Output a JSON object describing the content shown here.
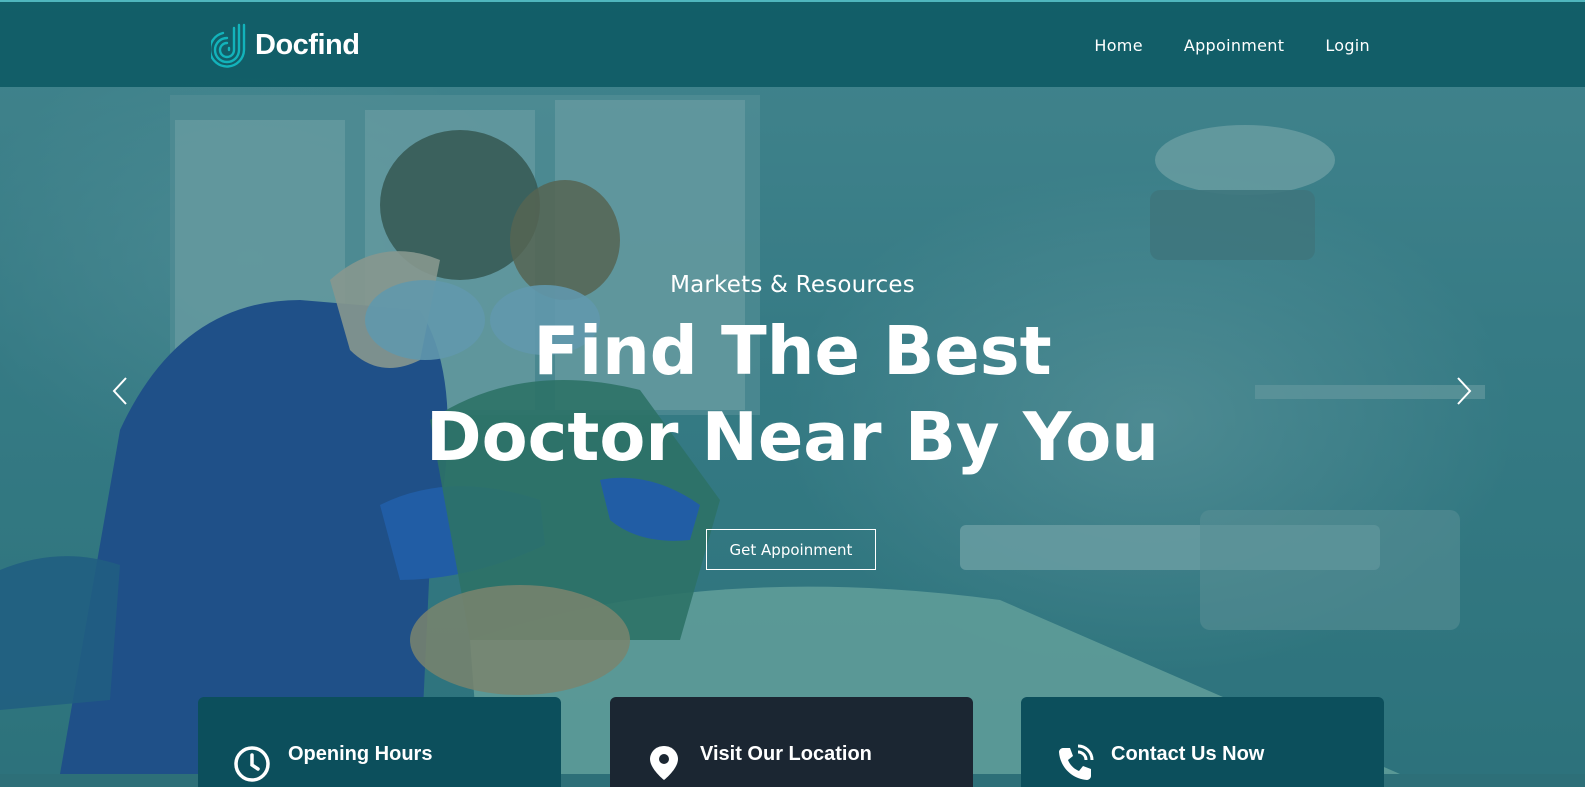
{
  "brand": {
    "name": "Docfind",
    "logo_icon": "docfind-logo-icon"
  },
  "nav": {
    "items": [
      "Home",
      "Appoinment",
      "Login"
    ]
  },
  "hero": {
    "kicker": "Markets & Resources",
    "title_line1": "Find The Best",
    "title_line2": "Doctor Near By You",
    "cta_label": "Get Appoinment",
    "prev_icon": "chevron-left-icon",
    "next_icon": "chevron-right-icon"
  },
  "cards": [
    {
      "title": "Opening Hours",
      "icon": "clock-icon"
    },
    {
      "title": "Visit Our Location",
      "icon": "map-pin-icon"
    },
    {
      "title": "Contact Us Now",
      "icon": "phone-icon"
    }
  ],
  "colors": {
    "topbar": "#0b5862",
    "card_teal": "#0c4f5c",
    "card_dark": "#1b2632",
    "accent": "#13b3bb"
  }
}
